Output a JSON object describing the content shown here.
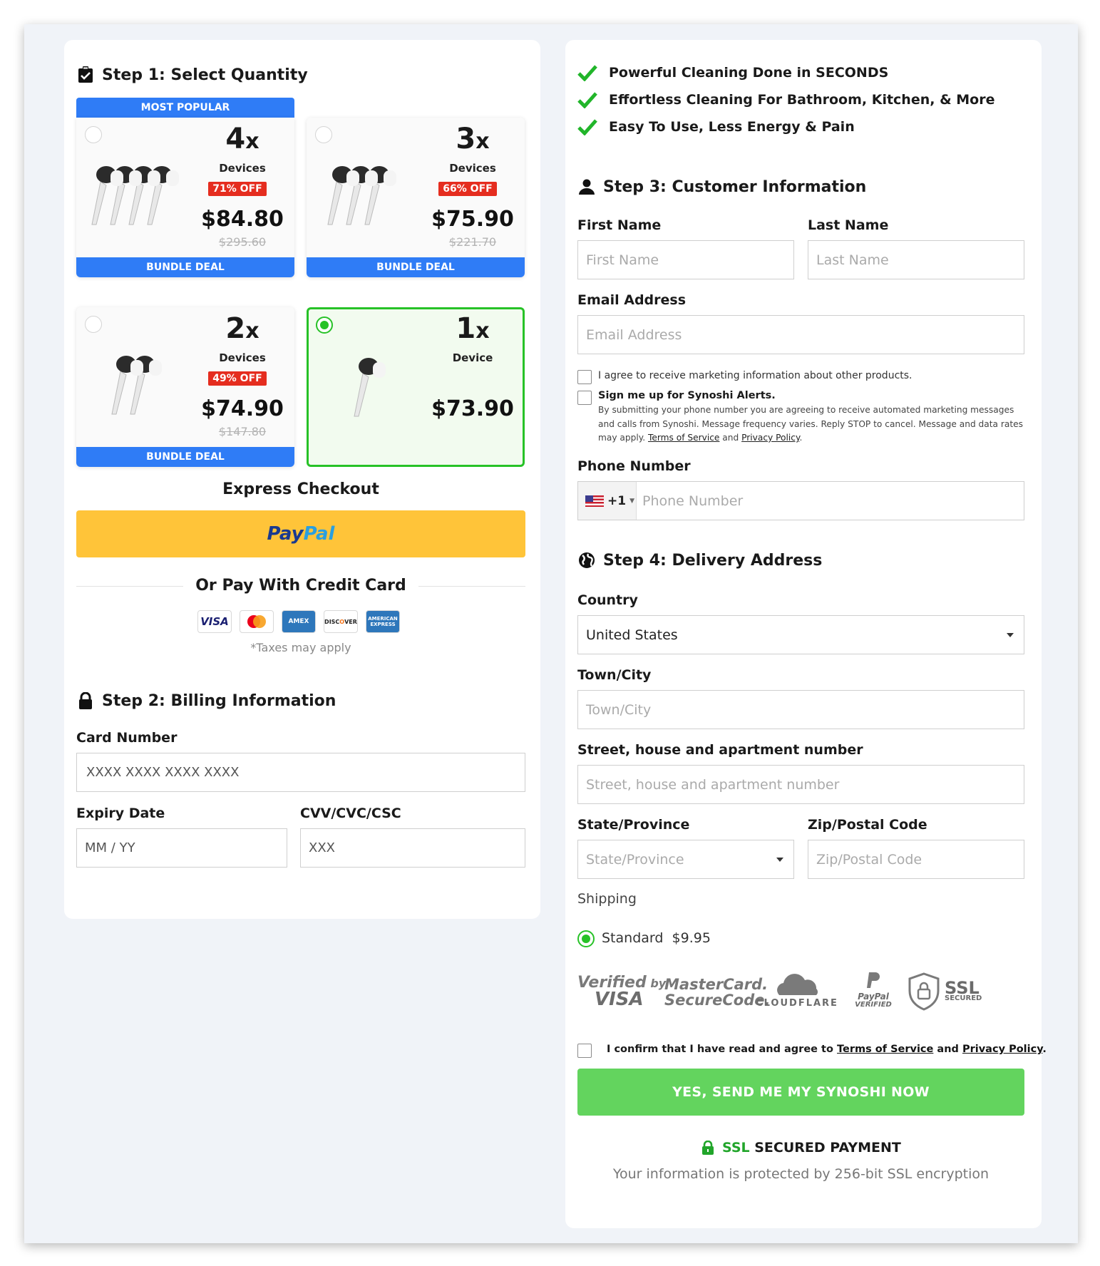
{
  "billing": {
    "step1_title": "Step 1: Select Quantity",
    "most_popular": "MOST POPULAR",
    "bundle_deal": "BUNDLE DEAL",
    "products": [
      {
        "qty": "4",
        "suffix": "x",
        "unit": "Devices",
        "off": "71% OFF",
        "price": "$84.80",
        "old_price": "$295.60",
        "selected": false
      },
      {
        "qty": "3",
        "suffix": "x",
        "unit": "Devices",
        "off": "66% OFF",
        "price": "$75.90",
        "old_price": "$221.70",
        "selected": false
      },
      {
        "qty": "2",
        "suffix": "x",
        "unit": "Devices",
        "off": "49% OFF",
        "price": "$74.90",
        "old_price": "$147.80",
        "selected": false
      },
      {
        "qty": "1",
        "suffix": "x",
        "unit": "Device",
        "off": "",
        "price": "$73.90",
        "old_price": "",
        "selected": true
      }
    ],
    "express_checkout": "Express Checkout",
    "paypal_1": "Pay",
    "paypal_2": "Pal",
    "or_pay": "Or Pay With Credit Card",
    "cards": [
      "VISA",
      "mastercard",
      "AMEX",
      "DISCOVER",
      "AMERICAN EXPRESS"
    ],
    "taxes": "*Taxes may apply",
    "step2_title": "Step 2: Billing Information",
    "card_number_label": "Card Number",
    "card_number_placeholder": "XXXX XXXX XXXX XXXX",
    "expiry_label": "Expiry Date",
    "expiry_placeholder": "MM / YY",
    "cvv_label": "CVV/CVC/CSC",
    "cvv_placeholder": "XXX"
  },
  "customer": {
    "benefits": [
      "Powerful Cleaning Done in SECONDS",
      "Effortless Cleaning For Bathroom, Kitchen, & More",
      "Easy To Use, Less Energy & Pain"
    ],
    "step3_title": "Step 3: Customer Information",
    "first_name_label": "First Name",
    "first_name_placeholder": "First Name",
    "last_name_label": "Last Name",
    "last_name_placeholder": "Last Name",
    "email_label": "Email Address",
    "email_placeholder": "Email Address",
    "marketing_consent": "I agree to receive marketing information about other products.",
    "alerts_title": "Sign me up for Synoshi Alerts.",
    "alerts_text": "By submitting your phone number you are agreeing to receive automated marketing messages and calls from Synoshi. Message frequency varies. Reply STOP to cancel. Message and data rates may apply.",
    "terms_link": "Terms of Service",
    "and_text": "and",
    "privacy_link": "Privacy Policy",
    "period": ".",
    "phone_label": "Phone Number",
    "phone_code": "+1",
    "phone_placeholder": "Phone Number"
  },
  "delivery": {
    "step4_title": "Step 4: Delivery Address",
    "country_label": "Country",
    "country_value": "United States",
    "city_label": "Town/City",
    "city_placeholder": "Town/City",
    "street_label": "Street, house and apartment number",
    "street_placeholder": "Street, house and apartment number",
    "state_label": "State/Province",
    "state_placeholder": "State/Province",
    "zip_label": "Zip/Postal Code",
    "zip_placeholder": "Zip/Postal Code",
    "shipping_label": "Shipping",
    "shipping_option": "Standard",
    "shipping_price": "$9.95"
  },
  "trust_badges": {
    "visa_1": "Verified",
    "visa_by": "by",
    "visa_2": "VISA",
    "mc_1": "MasterCard.",
    "mc_2": "SecureCode.",
    "cloudflare": "CLOUDFLARE",
    "paypal_1": "PayPal",
    "paypal_2": "VERIFIED",
    "ssl_1": "SSL",
    "ssl_2": "SECURED"
  },
  "footer": {
    "confirm_prefix": "I confirm that I have read and agree to",
    "confirm_terms": "Terms of Service",
    "confirm_and": "and",
    "confirm_privacy": "Privacy Policy",
    "confirm_suffix": ".",
    "cta": "YES, SEND ME MY SYNOSHI NOW",
    "ssl_green": "SSL",
    "ssl_rest": "SECURED PAYMENT",
    "ssl_sub": "Your information is protected by 256-bit SSL encryption"
  },
  "colors": {
    "accent_blue": "#2f7cf6",
    "green": "#27c227",
    "cta_green": "#63d45e",
    "paypal_yellow": "#ffc439",
    "discount_red": "#e52d1f"
  }
}
